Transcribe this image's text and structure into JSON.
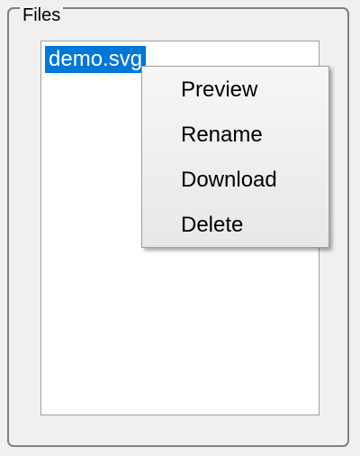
{
  "groupbox": {
    "title": "Files"
  },
  "listbox": {
    "items": [
      {
        "label": "demo.svg",
        "selected": true
      }
    ],
    "selection_color": "#0078d7"
  },
  "context_menu": {
    "items": [
      {
        "label": "Preview"
      },
      {
        "label": "Rename"
      },
      {
        "label": "Download"
      },
      {
        "label": "Delete"
      }
    ]
  }
}
